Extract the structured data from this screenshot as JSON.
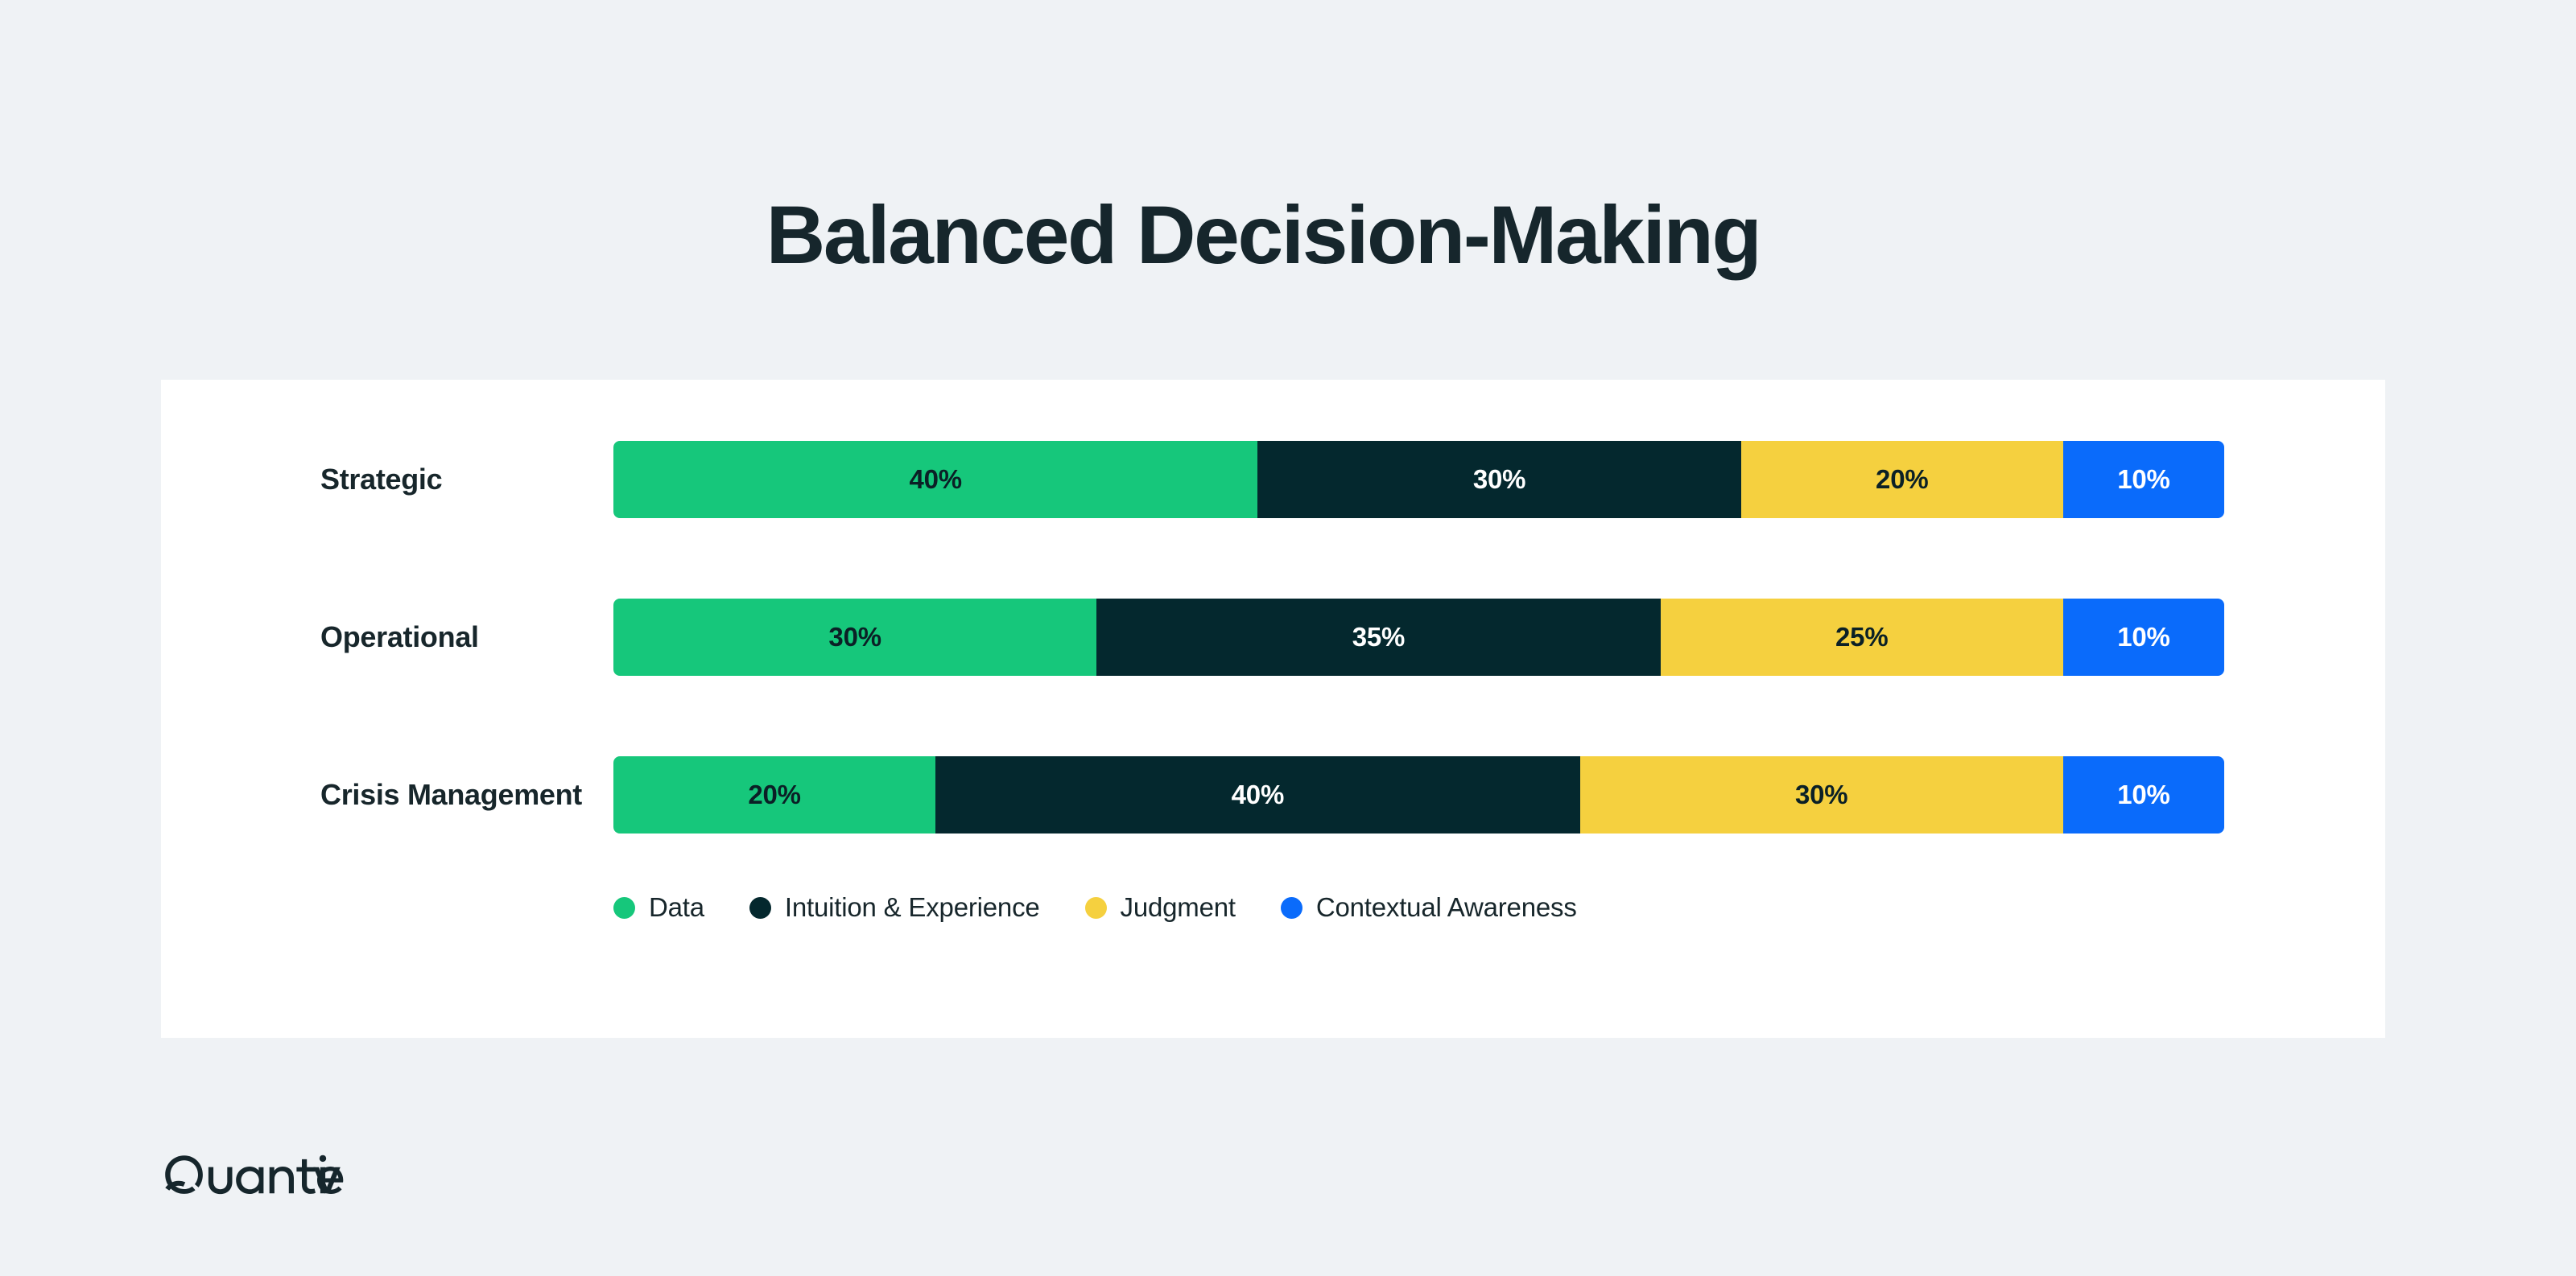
{
  "title": "Balanced Decision-Making",
  "brand": {
    "name": "Quantive",
    "logo_icon": "quantive-wordmark"
  },
  "colors": {
    "background": "#eff2f5",
    "card": "#ffffff",
    "title_text": "#16262c",
    "label_text": "#17262b",
    "data_green": "#16c77b",
    "intuition_navy": "#04282e",
    "judgment_yellow": "#f5d03f",
    "contextual_blue": "#0a6bfb",
    "dark_on_light": "#0b2026",
    "light_on_dark": "#ffffff"
  },
  "legend": {
    "items": [
      {
        "label": "Data",
        "color": "#16c77b",
        "icon": "legend-dot-icon"
      },
      {
        "label": "Intuition & Experience",
        "color": "#04282e",
        "icon": "legend-dot-icon"
      },
      {
        "label": "Judgment",
        "color": "#f5d03f",
        "icon": "legend-dot-icon"
      },
      {
        "label": "Contextual Awareness",
        "color": "#0a6bfb",
        "icon": "legend-dot-icon"
      }
    ]
  },
  "chart_data": {
    "type": "bar",
    "orientation": "horizontal",
    "stacked": true,
    "normalized": true,
    "title": "Balanced Decision-Making",
    "xlabel": "",
    "ylabel": "",
    "xlim": [
      0,
      100
    ],
    "grid": false,
    "legend_position": "bottom-left",
    "value_suffix": "%",
    "categories": [
      "Strategic",
      "Operational",
      "Crisis Management"
    ],
    "series": [
      {
        "name": "Data",
        "color": "#16c77b",
        "label_color": "#0b2026",
        "values": [
          40,
          30,
          20
        ]
      },
      {
        "name": "Intuition & Experience",
        "color": "#04282e",
        "label_color": "#ffffff",
        "values": [
          30,
          35,
          40
        ]
      },
      {
        "name": "Judgment",
        "color": "#f5d03f",
        "label_color": "#0b2026",
        "values": [
          20,
          25,
          30
        ]
      },
      {
        "name": "Contextual Awareness",
        "color": "#0a6bfb",
        "label_color": "#ffffff",
        "values": [
          10,
          10,
          10
        ]
      }
    ],
    "rows": [
      {
        "category": "Strategic",
        "segments": [
          {
            "series": "Data",
            "value": 40,
            "label": "40%"
          },
          {
            "series": "Intuition & Experience",
            "value": 30,
            "label": "30%"
          },
          {
            "series": "Judgment",
            "value": 20,
            "label": "20%"
          },
          {
            "series": "Contextual Awareness",
            "value": 10,
            "label": "10%"
          }
        ]
      },
      {
        "category": "Operational",
        "segments": [
          {
            "series": "Data",
            "value": 30,
            "label": "30%"
          },
          {
            "series": "Intuition & Experience",
            "value": 35,
            "label": "35%"
          },
          {
            "series": "Judgment",
            "value": 25,
            "label": "25%"
          },
          {
            "series": "Contextual Awareness",
            "value": 10,
            "label": "10%"
          }
        ]
      },
      {
        "category": "Crisis Management",
        "segments": [
          {
            "series": "Data",
            "value": 20,
            "label": "20%"
          },
          {
            "series": "Intuition & Experience",
            "value": 40,
            "label": "40%"
          },
          {
            "series": "Judgment",
            "value": 30,
            "label": "30%"
          },
          {
            "series": "Contextual Awareness",
            "value": 10,
            "label": "10%"
          }
        ]
      }
    ]
  }
}
